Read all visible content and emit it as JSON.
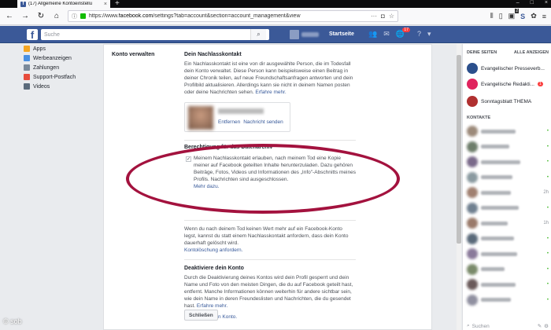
{
  "browser": {
    "tab_title": "(17) Allgemeine Kontoeinstellu",
    "url_prefix": "https://www.",
    "url_domain": "facebook.com",
    "url_rest": "/settings?tab=account&section=account_management&view",
    "tools_badge": "2"
  },
  "fb": {
    "search_placeholder": "Suche",
    "home_label": "Startseite",
    "notifications_count": "17"
  },
  "leftnav": {
    "items": [
      {
        "label": "Apps",
        "color": "#f5a623"
      },
      {
        "label": "Werbeanzeigen",
        "color": "#4a90e2"
      },
      {
        "label": "Zahlungen",
        "color": "#7b8a9a"
      },
      {
        "label": "Support-Postfach",
        "color": "#e74c3c"
      },
      {
        "label": "Videos",
        "color": "#5b6b7b"
      }
    ]
  },
  "main": {
    "section_label": "Konto verwalten",
    "legacy_heading": "Dein Nachlasskontakt",
    "legacy_text": "Ein Nachlasskontakt ist eine von dir ausgewählte Person, die im Todesfall dein Konto verwaltet. Diese Person kann beispielsweise einen Beitrag in deiner Chronik teilen, auf neue Freundschaftsanfragen antworten und dein Profilbild aktualisieren. Allerdings kann sie nicht in deinem Namen posten oder deine Nachrichten sehen.",
    "legacy_link": "Erfahre mehr.",
    "contact_remove": "Entfernen",
    "contact_message": "Nachricht senden",
    "archive_heading": "Berechtigung für das Datenarchiv",
    "archive_text": "Meinem Nachlasskontakt erlauben, nach meinem Tod eine Kopie meiner auf Facebook geteilten Inhalte herunterzuladen. Dazu gehören Beiträge, Fotos, Videos und Informationen des „Info\"-Abschnitts meines Profils. Nachrichten sind ausgeschlossen.",
    "archive_link": "Mehr dazu.",
    "delete_text": "Wenn du nach deinem Tod keinen Wert mehr auf ein Facebook-Konto legst, kannst du statt einem Nachlasskontakt anfordern, dass dein Konto dauerhaft gelöscht wird.",
    "delete_link": "Kontolöschung anfordern.",
    "deactivate_heading": "Deaktiviere dein Konto",
    "deactivate_text": "Durch die Deaktivierung deines Kontos wird dein Profil gesperrt und dein Name und Foto von den meisten Dingen, die du auf Facebook geteilt hast, entfernt. Manche Informationen können weiterhin für andere sichtbar sein, wie dein Name in deren Freundeslisten und Nachrichten, die du gesendet hast.",
    "deactivate_more": "Erfahre mehr.",
    "deactivate_link": "Deaktiviere dein Konto.",
    "close_button": "Schließen"
  },
  "right": {
    "pages_heading": "DEINE SEITEN",
    "pages_all": "ALLE ANZEIGEN",
    "pages": [
      {
        "label": "Evangelischer Presseverb...",
        "color": "#2b4f8c"
      },
      {
        "label": "Evangelische Redakti...",
        "badge": "1",
        "color": "#e0245e"
      },
      {
        "label": "Sonntagsblatt THEMA",
        "color": "#b03030"
      }
    ],
    "contacts_heading": "KONTAKTE",
    "contacts": [
      {
        "status": "•",
        "color": "#9c8a7a"
      },
      {
        "status": "•",
        "color": "#6d7d6a"
      },
      {
        "status": "•",
        "color": "#7a6a8a"
      },
      {
        "status": "•",
        "color": "#8a9aa0"
      },
      {
        "status": "2h",
        "color": "#a08070"
      },
      {
        "status": "•",
        "color": "#708090"
      },
      {
        "status": "1h",
        "color": "#9a7a6a"
      },
      {
        "status": "•",
        "color": "#5a6a7a"
      },
      {
        "status": "•",
        "color": "#8a7a9a"
      },
      {
        "status": "•",
        "color": "#7a8a6a"
      },
      {
        "status": "•",
        "color": "#6a5a5a"
      },
      {
        "status": "•",
        "color": "#9090a0"
      }
    ],
    "search_placeholder": "Suchen"
  },
  "watermark": "© sob",
  "accent": "#a3123e"
}
